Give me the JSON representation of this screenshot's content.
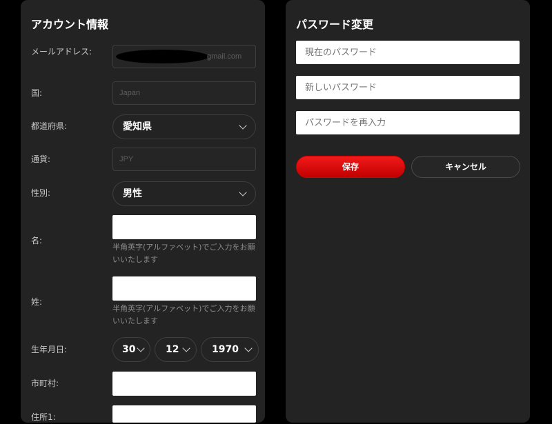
{
  "account": {
    "title": "アカウント情報",
    "email_label": "メールアドレス:",
    "email_domain": "gmail.com",
    "country_label": "国:",
    "country_value": "Japan",
    "prefecture_label": "都道府県:",
    "prefecture_value": "愛知県",
    "currency_label": "通貨:",
    "currency_value": "JPY",
    "gender_label": "性別:",
    "gender_value": "男性",
    "first_name_label": "名:",
    "first_name_hint": "半角英字(アルファベット)でご入力をお願いいたします",
    "last_name_label": "姓:",
    "last_name_hint": "半角英字(アルファベット)でご入力をお願いいたします",
    "birthdate_label": "生年月日:",
    "birth_day": "30",
    "birth_month": "12",
    "birth_year": "1970",
    "city_label": "市町村:",
    "address1_label": "住所1:"
  },
  "password": {
    "title": "パスワード変更",
    "current_placeholder": "現在のパスワード",
    "new_placeholder": "新しいパスワード",
    "confirm_placeholder": "パスワードを再入力",
    "save_label": "保存",
    "cancel_label": "キャンセル"
  },
  "colors": {
    "background": "#000000",
    "panel": "#232323",
    "accent_red": "#e00000"
  },
  "icons": {
    "select_chevron": "chevron-down-icon"
  }
}
